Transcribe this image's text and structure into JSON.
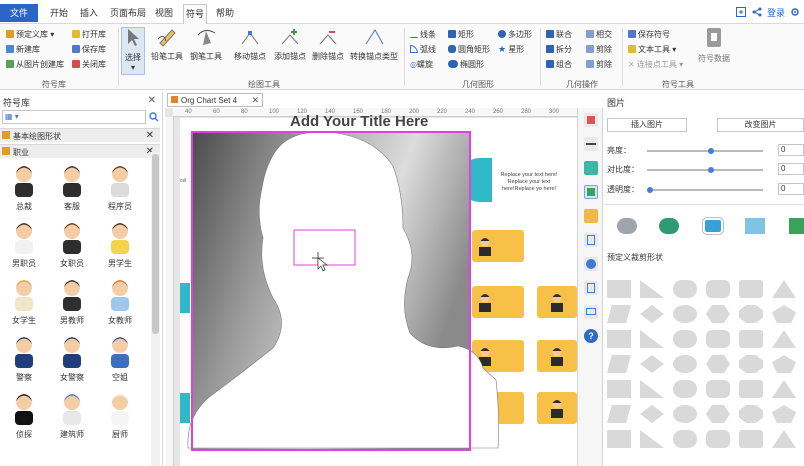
{
  "menu": {
    "file": "文件",
    "items": [
      "开始",
      "插入",
      "页面布局",
      "视图",
      "符号",
      "帮助"
    ],
    "active": "符号",
    "right": {
      "login": "登录"
    }
  },
  "ribbon": {
    "library_group": {
      "label": "符号库",
      "items": [
        "预定义库",
        "打开库",
        "新建库",
        "保存库",
        "从图片创建库",
        "关闭库"
      ]
    },
    "drawing_group": {
      "label": "绘图工具",
      "tools": [
        "选择",
        "铅笔工具",
        "钢笔工具",
        "移动锚点",
        "添加锚点",
        "删除锚点",
        "转换锚点类型"
      ]
    },
    "geometry_group": {
      "label": "几何图形",
      "items": [
        "线条",
        "矩形",
        "多边形",
        "弧线",
        "圆角矩形",
        "星形",
        "螺旋",
        "椭圆形"
      ]
    },
    "ops_group": {
      "label": "几何操作",
      "items": [
        "联合",
        "相交",
        "拆分",
        "剪除",
        "组合",
        "剪除"
      ]
    },
    "symbol_tools_group": {
      "label": "符号工具",
      "items": [
        "保存符号",
        "文本工具",
        "连接点工具"
      ],
      "big": "符号数据"
    }
  },
  "library": {
    "title": "符号库",
    "categories": [
      "基本绘图形状",
      "职业"
    ],
    "figures": [
      "总裁",
      "客服",
      "程序员",
      "男职员",
      "女职员",
      "男学生",
      "女学生",
      "男教师",
      "女教师",
      "警察",
      "女警察",
      "空姐",
      "侦探",
      "建筑师",
      "厨师"
    ]
  },
  "document": {
    "tab": "Org Chart Set 4",
    "canvas_title": "Add Your Title Here",
    "ruler_marks": [
      "40",
      "60",
      "80",
      "100",
      "120",
      "140",
      "160",
      "180",
      "200",
      "220",
      "240",
      "260",
      "280",
      "300"
    ],
    "replace_text": "Replace your text here! Replace your text here!Replace yo here!"
  },
  "panel": {
    "title": "图片",
    "insert": "插入图片",
    "change": "改变图片",
    "sliders": [
      {
        "label": "亮度：",
        "value": "0",
        "level": 0.55
      },
      {
        "label": "对比度：",
        "value": "0",
        "level": 0.55
      },
      {
        "label": "透明度：",
        "value": "0",
        "level": 0.03
      }
    ],
    "crop_label": "预定义裁剪形状"
  },
  "colors": {
    "accent": "#2b66c6",
    "selection": "#e040e0",
    "org_box": "#f7c046",
    "teal": "#30b9c9"
  }
}
